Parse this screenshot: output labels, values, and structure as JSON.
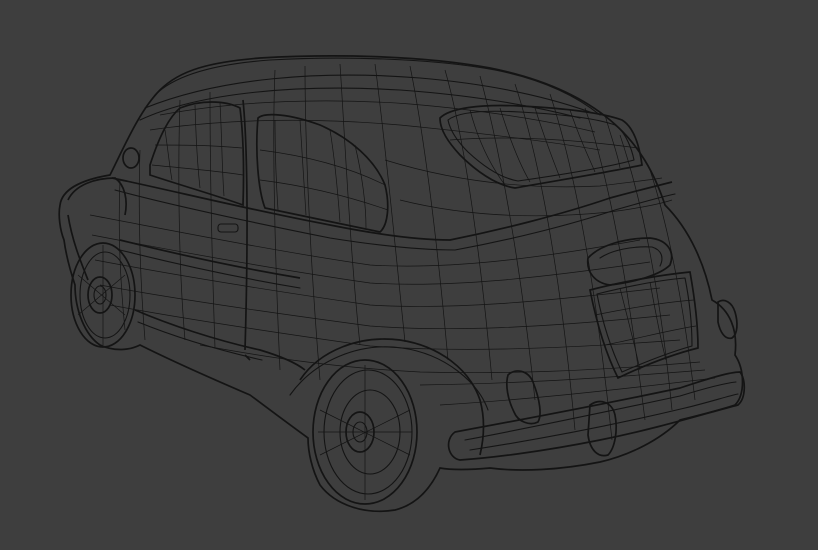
{
  "viewport": {
    "background_color": "#3e3e3e",
    "wire_color": "#141414",
    "subject": "car-wireframe"
  }
}
